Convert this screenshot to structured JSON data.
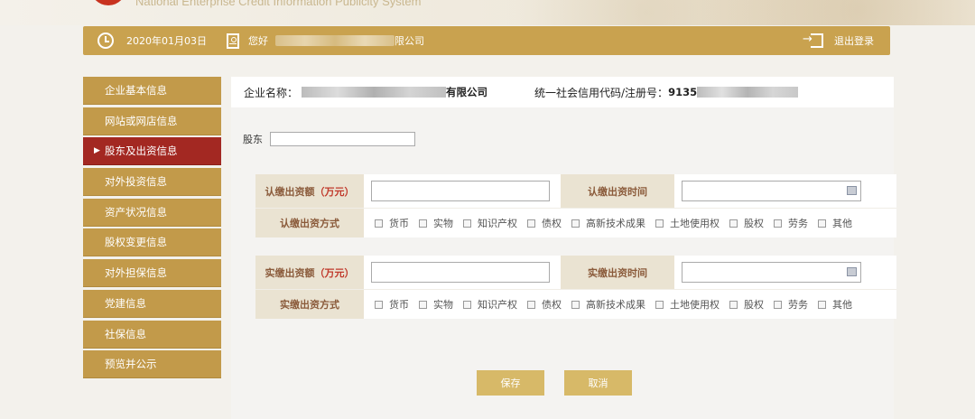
{
  "banner": {
    "site_name": "National Enterprise Credit Information Publicity System"
  },
  "userbar": {
    "date": "2020年01月03日",
    "greeting": "您好",
    "company_suffix": "限公司",
    "logout": "退出登录",
    "icons": [
      "clock-icon",
      "user-icon",
      "logout-icon"
    ]
  },
  "sidebar": {
    "items": [
      {
        "label": "企业基本信息",
        "active": false
      },
      {
        "label": "网站或网店信息",
        "active": false
      },
      {
        "label": "股东及出资信息",
        "active": true
      },
      {
        "label": "对外投资信息",
        "active": false
      },
      {
        "label": "资产状况信息",
        "active": false
      },
      {
        "label": "股权变更信息",
        "active": false
      },
      {
        "label": "对外担保信息",
        "active": false
      },
      {
        "label": "党建信息",
        "active": false
      },
      {
        "label": "社保信息",
        "active": false
      },
      {
        "label": "预览并公示",
        "active": false
      }
    ],
    "active_arrow": "▶"
  },
  "company": {
    "name_label": "企业名称：",
    "name_suffix": "有限公司",
    "reg_label": "统一社会信用代码/注册号：",
    "reg_prefix": "9135"
  },
  "shareholder": {
    "label": "股东",
    "value": ""
  },
  "subscribed": {
    "amount_label": "认缴出资额",
    "amount_unit": "（万元）",
    "amount_value": "",
    "time_label": "认缴出资时间",
    "time_value": "",
    "method_label": "认缴出资方式",
    "methods": [
      "货币",
      "实物",
      "知识产权",
      "债权",
      "高新技术成果",
      "土地使用权",
      "股权",
      "劳务",
      "其他"
    ]
  },
  "paid": {
    "amount_label": "实缴出资额",
    "amount_unit": "（万元）",
    "amount_value": "",
    "time_label": "实缴出资时间",
    "time_value": "",
    "method_label": "实缴出资方式",
    "methods": [
      "货币",
      "实物",
      "知识产权",
      "债权",
      "高新技术成果",
      "土地使用权",
      "股权",
      "劳务",
      "其他"
    ]
  },
  "buttons": {
    "save": "保存",
    "cancel": "取消"
  },
  "colors": {
    "gold": "#c9a24f",
    "sidebar": "#c29a4a",
    "active": "#a32822",
    "label_bg": "#eae3d2",
    "button": "#d7b968"
  }
}
